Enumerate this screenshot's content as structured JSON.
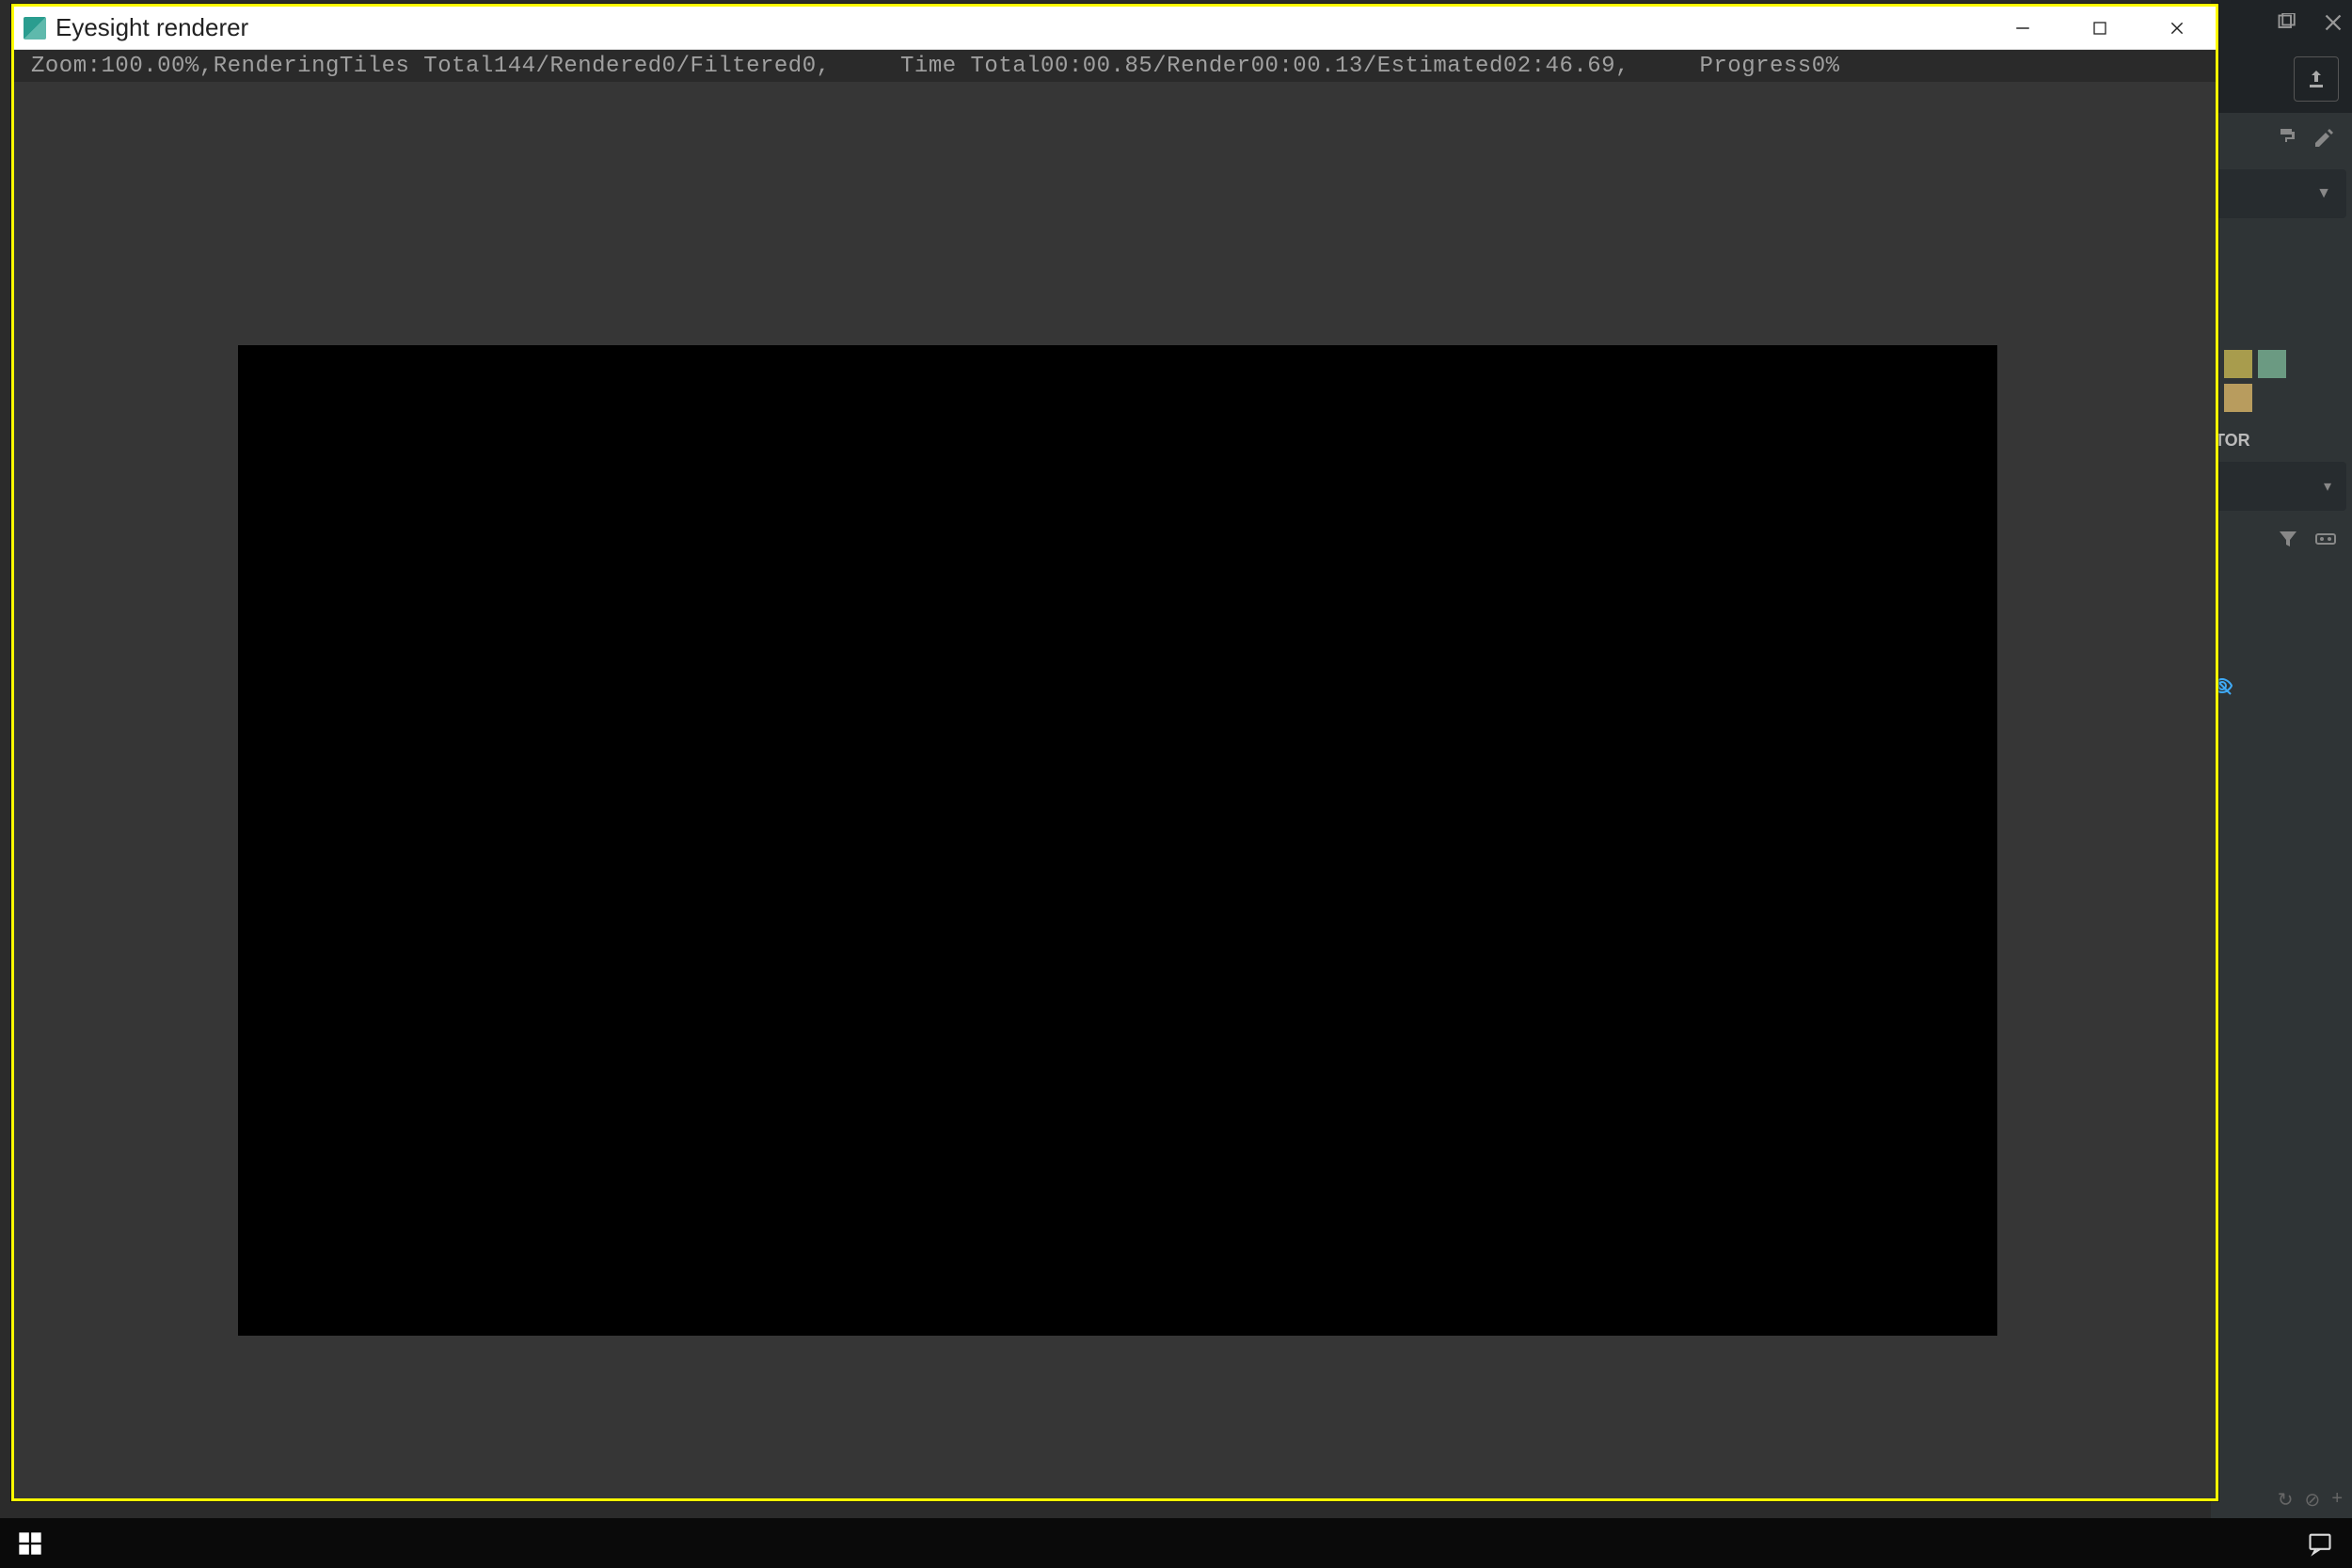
{
  "window": {
    "title": "Eyesight renderer"
  },
  "status": {
    "zoom_label": "Zoom:",
    "zoom_value": "100.00%",
    "state": "Rendering",
    "tiles_label": "Tiles Total",
    "tiles_total": "144",
    "tiles_rendered_label": "Rendered",
    "tiles_rendered": "0",
    "tiles_filtered_label": "Filtered",
    "tiles_filtered": "0",
    "time_label": "Time Total",
    "time_total": "00:00.85",
    "render_label": "Render",
    "render_time": "00:00.13",
    "estimated_label": "Estimated",
    "estimated_time": "02:46.69",
    "progress_label": "Progress",
    "progress_value": "0%"
  },
  "bg_app": {
    "section_label": "TOR",
    "swatches": [
      "#a89c4d",
      "#6b9a82",
      "#b89c5e"
    ]
  },
  "colors": {
    "highlight": "#fffc00",
    "viewport_bg": "#363636",
    "render_black": "#000000"
  }
}
